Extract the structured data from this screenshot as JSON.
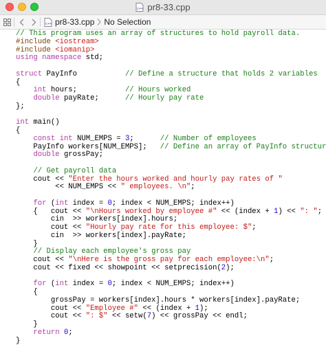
{
  "window": {
    "title": "pr8-33.cpp"
  },
  "jumpbar": {
    "file": "pr8-33.cpp",
    "selection": "No Selection"
  },
  "code_lines": [
    [
      {
        "t": "// This program uses an array of structures to hold payroll data.",
        "c": "c"
      }
    ],
    [
      {
        "t": "#include ",
        "c": "p"
      },
      {
        "t": "<iostream>",
        "c": "s"
      }
    ],
    [
      {
        "t": "#include ",
        "c": "p"
      },
      {
        "t": "<iomanip>",
        "c": "s"
      }
    ],
    [
      {
        "t": "using namespace",
        "c": "k"
      },
      {
        "t": " std;",
        "c": ""
      }
    ],
    [
      {
        "t": "",
        "c": ""
      }
    ],
    [
      {
        "t": "struct",
        "c": "k"
      },
      {
        "t": " PayInfo           ",
        "c": ""
      },
      {
        "t": "// Define a structure that holds 2 variables",
        "c": "c"
      }
    ],
    [
      {
        "t": "{",
        "c": ""
      }
    ],
    [
      {
        "t": "    ",
        "c": ""
      },
      {
        "t": "int",
        "c": "k"
      },
      {
        "t": " hours;           ",
        "c": ""
      },
      {
        "t": "// Hours worked",
        "c": "c"
      }
    ],
    [
      {
        "t": "    ",
        "c": ""
      },
      {
        "t": "double",
        "c": "k"
      },
      {
        "t": " payRate;      ",
        "c": ""
      },
      {
        "t": "// Hourly pay rate",
        "c": "c"
      }
    ],
    [
      {
        "t": "};",
        "c": ""
      }
    ],
    [
      {
        "t": "",
        "c": ""
      }
    ],
    [
      {
        "t": "int",
        "c": "k"
      },
      {
        "t": " main()",
        "c": ""
      }
    ],
    [
      {
        "t": "{",
        "c": ""
      }
    ],
    [
      {
        "t": "    ",
        "c": ""
      },
      {
        "t": "const int",
        "c": "k"
      },
      {
        "t": " NUM_EMPS = ",
        "c": ""
      },
      {
        "t": "3",
        "c": "n"
      },
      {
        "t": ";      ",
        "c": ""
      },
      {
        "t": "// Number of employees",
        "c": "c"
      }
    ],
    [
      {
        "t": "    PayInfo workers[NUM_EMPS];   ",
        "c": ""
      },
      {
        "t": "// Define an array of PayInfo structures",
        "c": "c"
      }
    ],
    [
      {
        "t": "    ",
        "c": ""
      },
      {
        "t": "double",
        "c": "k"
      },
      {
        "t": " grossPay;",
        "c": ""
      }
    ],
    [
      {
        "t": "",
        "c": ""
      }
    ],
    [
      {
        "t": "    ",
        "c": ""
      },
      {
        "t": "// Get payroll data",
        "c": "c"
      }
    ],
    [
      {
        "t": "    cout << ",
        "c": ""
      },
      {
        "t": "\"Enter the hours worked and hourly pay rates of \"",
        "c": "s"
      }
    ],
    [
      {
        "t": "         << NUM_EMPS << ",
        "c": ""
      },
      {
        "t": "\" employees. \\n\"",
        "c": "s"
      },
      {
        "t": ";",
        "c": ""
      }
    ],
    [
      {
        "t": "",
        "c": ""
      }
    ],
    [
      {
        "t": "    ",
        "c": ""
      },
      {
        "t": "for",
        "c": "k"
      },
      {
        "t": " (",
        "c": ""
      },
      {
        "t": "int",
        "c": "k"
      },
      {
        "t": " index = ",
        "c": ""
      },
      {
        "t": "0",
        "c": "n"
      },
      {
        "t": "; index < NUM_EMPS; index++)",
        "c": ""
      }
    ],
    [
      {
        "t": "    {   cout << ",
        "c": ""
      },
      {
        "t": "\"\\nHours worked by employee #\"",
        "c": "s"
      },
      {
        "t": " << (index + ",
        "c": ""
      },
      {
        "t": "1",
        "c": "n"
      },
      {
        "t": ") << ",
        "c": ""
      },
      {
        "t": "\": \"",
        "c": "s"
      },
      {
        "t": ";",
        "c": ""
      }
    ],
    [
      {
        "t": "        cin  >> workers[index].hours;",
        "c": ""
      }
    ],
    [
      {
        "t": "        cout << ",
        "c": ""
      },
      {
        "t": "\"Hourly pay rate for this employee: $\"",
        "c": "s"
      },
      {
        "t": ";",
        "c": ""
      }
    ],
    [
      {
        "t": "        cin  >> workers[index].payRate;",
        "c": ""
      }
    ],
    [
      {
        "t": "    }",
        "c": ""
      }
    ],
    [
      {
        "t": "    ",
        "c": ""
      },
      {
        "t": "// Display each employee's gross pay",
        "c": "c"
      }
    ],
    [
      {
        "t": "    cout << ",
        "c": ""
      },
      {
        "t": "\"\\nHere is the gross pay for each employee:\\n\"",
        "c": "s"
      },
      {
        "t": ";",
        "c": ""
      }
    ],
    [
      {
        "t": "    cout << fixed << showpoint << setprecision(",
        "c": ""
      },
      {
        "t": "2",
        "c": "n"
      },
      {
        "t": ");",
        "c": ""
      }
    ],
    [
      {
        "t": "",
        "c": ""
      }
    ],
    [
      {
        "t": "    ",
        "c": ""
      },
      {
        "t": "for",
        "c": "k"
      },
      {
        "t": " (",
        "c": ""
      },
      {
        "t": "int",
        "c": "k"
      },
      {
        "t": " index = ",
        "c": ""
      },
      {
        "t": "0",
        "c": "n"
      },
      {
        "t": "; index < NUM_EMPS; index++)",
        "c": ""
      }
    ],
    [
      {
        "t": "    {",
        "c": ""
      }
    ],
    [
      {
        "t": "        grossPay = workers[index].hours * workers[index].payRate;",
        "c": ""
      }
    ],
    [
      {
        "t": "        cout << ",
        "c": ""
      },
      {
        "t": "\"Employee #\"",
        "c": "s"
      },
      {
        "t": " << (index + ",
        "c": ""
      },
      {
        "t": "1",
        "c": "n"
      },
      {
        "t": ");",
        "c": ""
      }
    ],
    [
      {
        "t": "        cout << ",
        "c": ""
      },
      {
        "t": "\": $\"",
        "c": "s"
      },
      {
        "t": " << setw(",
        "c": ""
      },
      {
        "t": "7",
        "c": "n"
      },
      {
        "t": ") << grossPay << endl;",
        "c": ""
      }
    ],
    [
      {
        "t": "    }",
        "c": ""
      }
    ],
    [
      {
        "t": "    ",
        "c": ""
      },
      {
        "t": "return",
        "c": "k"
      },
      {
        "t": " ",
        "c": ""
      },
      {
        "t": "0",
        "c": "n"
      },
      {
        "t": ";",
        "c": ""
      }
    ],
    [
      {
        "t": "}",
        "c": ""
      }
    ]
  ],
  "colors": {
    "comment": "#1a7f1a",
    "keyword": "#ad3da4",
    "preprocessor": "#7b3f00",
    "string": "#c41a16",
    "number": "#1c00cf"
  },
  "icons": [
    "close-button",
    "minimize-button",
    "zoom-button",
    "cpp-file-icon",
    "related-items-icon",
    "back-icon",
    "forward-icon"
  ]
}
